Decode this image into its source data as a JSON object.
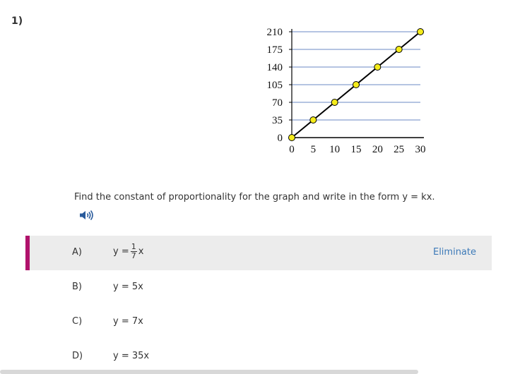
{
  "question": {
    "number": "1)",
    "prompt": "Find the constant of proportionality for the graph and write in the form y = kx.",
    "audio_icon": "speaker-icon"
  },
  "chart_data": {
    "type": "line",
    "x": [
      0,
      5,
      10,
      15,
      20,
      25,
      30
    ],
    "series": [
      {
        "values": [
          0,
          35,
          70,
          105,
          140,
          175,
          210
        ]
      }
    ],
    "x_ticks": [
      "0",
      "5",
      "10",
      "15",
      "20",
      "25",
      "30"
    ],
    "y_ticks": [
      "0",
      "35",
      "70",
      "105",
      "140",
      "175",
      "210"
    ],
    "xlim": [
      0,
      30
    ],
    "ylim": [
      0,
      210
    ],
    "grid": "horizontal",
    "line_color": "#000000",
    "marker_color": "#f5ec1b",
    "grid_color": "#6b88c4"
  },
  "answers": [
    {
      "letter": "A)",
      "prefix": "y = ",
      "numerator": "1",
      "denominator": "7",
      "suffix": "x",
      "eliminate": "Eliminate"
    },
    {
      "letter": "B)",
      "text": "y = 5x"
    },
    {
      "letter": "C)",
      "text": "y = 7x"
    },
    {
      "letter": "D)",
      "text": "y = 35x"
    }
  ],
  "colors": {
    "selected_accent": "#b0126b",
    "selected_bg": "#ececec",
    "link": "#3d7ab8"
  }
}
